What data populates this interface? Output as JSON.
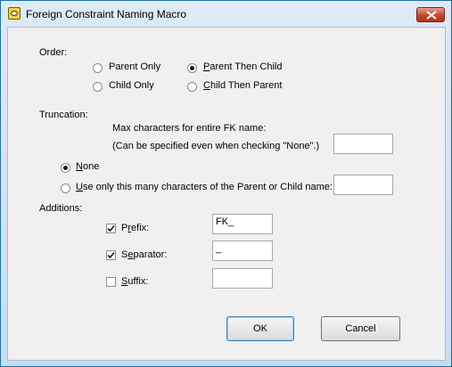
{
  "window": {
    "title": "Foreign Constraint Naming Macro",
    "close_glyph": "✕"
  },
  "order": {
    "label": "Order:",
    "options": [
      {
        "label": "Parent Only",
        "selected": false
      },
      {
        "label": "Parent Then Child",
        "selected": true
      },
      {
        "label": "Child Only",
        "selected": false
      },
      {
        "label": "Child Then Parent",
        "selected": false
      }
    ]
  },
  "truncation": {
    "label": "Truncation:",
    "max_line1": "Max characters for entire FK name:",
    "max_line2": "(Can be specified even when checking \"None\".)",
    "max_value": "",
    "options": [
      {
        "label": "None",
        "selected": true
      },
      {
        "label": "Use only this many characters of the Parent or Child name:",
        "selected": false
      }
    ],
    "chars_value": ""
  },
  "additions": {
    "label": "Additions:",
    "items": [
      {
        "label": "Prefix:",
        "checked": true,
        "value": "FK_"
      },
      {
        "label": "Separator:",
        "checked": true,
        "value": "_"
      },
      {
        "label": "Suffix:",
        "checked": false,
        "value": ""
      }
    ]
  },
  "buttons": {
    "ok": "OK",
    "cancel": "Cancel"
  }
}
